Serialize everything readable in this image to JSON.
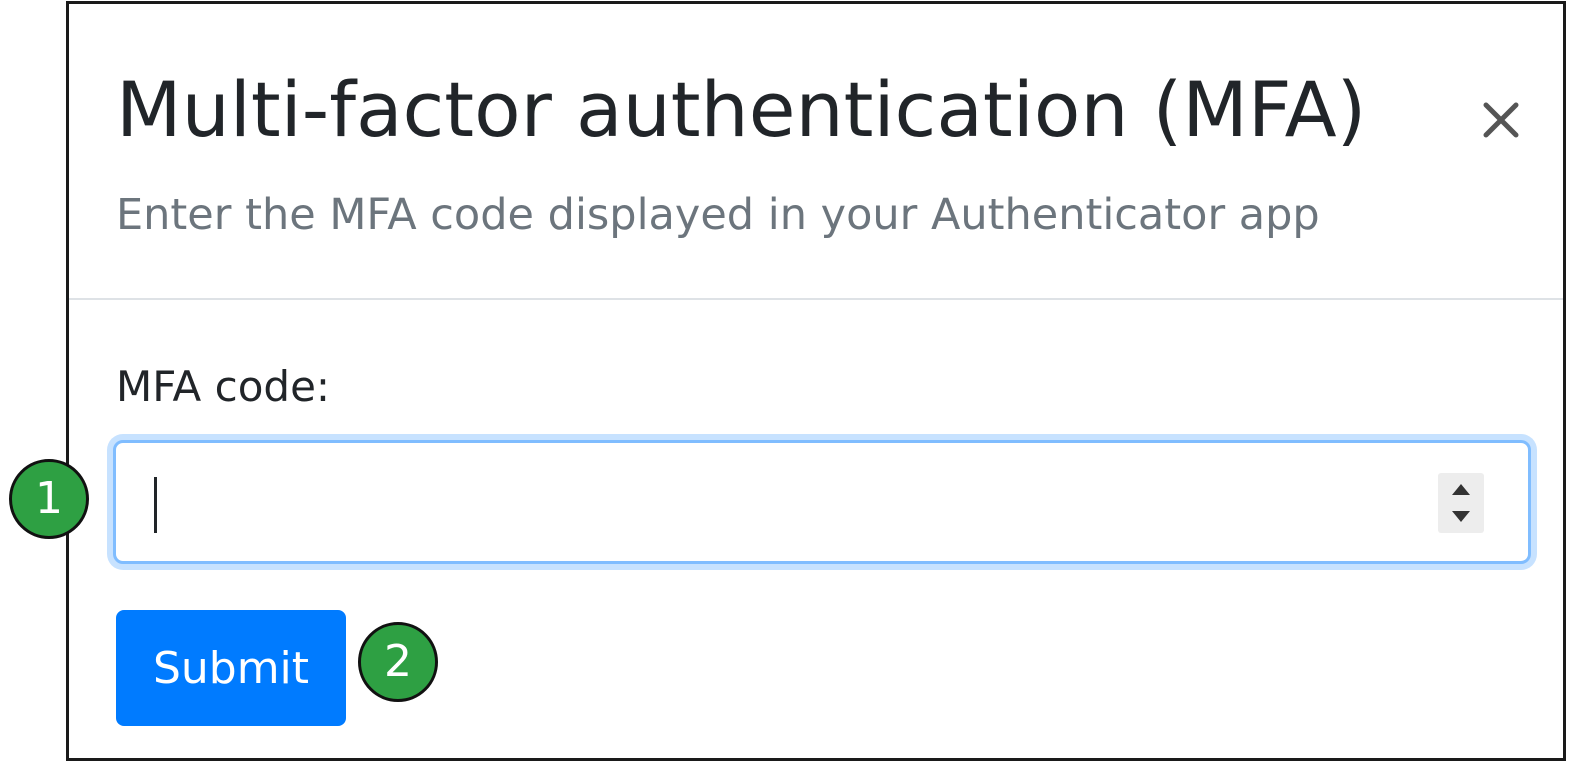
{
  "modal": {
    "title": "Multi-factor authentication (MFA)",
    "subtitle": "Enter the MFA code displayed in your Authenticator app",
    "close_icon": "close-icon"
  },
  "form": {
    "code_label": "MFA code:",
    "code_value": "",
    "code_placeholder": "",
    "submit_label": "Submit"
  },
  "annotations": {
    "badge_1": "1",
    "badge_2": "2"
  },
  "colors": {
    "primary": "#007bff",
    "focus_border": "#80bdff",
    "badge": "#2ea043",
    "text": "#212529",
    "muted": "#6c757d"
  }
}
